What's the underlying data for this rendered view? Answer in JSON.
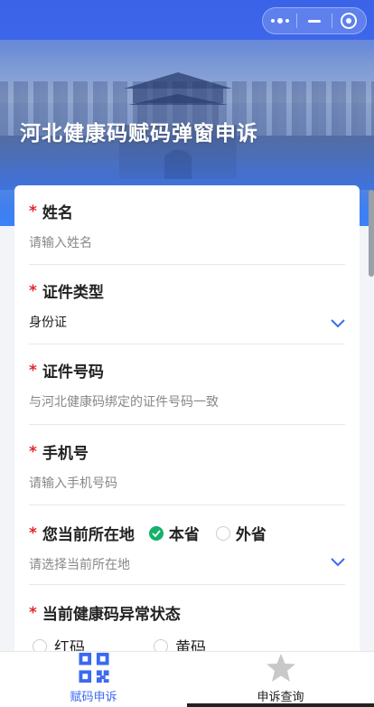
{
  "header": {
    "title": "河北健康码赋码弹窗申诉",
    "capsule": [
      "more-icon",
      "minimize-icon",
      "close-target-icon"
    ]
  },
  "form": {
    "required_mark": "*",
    "name": {
      "label": "姓名",
      "placeholder": "请输入姓名"
    },
    "id_type": {
      "label": "证件类型",
      "value": "身份证"
    },
    "id_number": {
      "label": "证件号码",
      "placeholder": "与河北健康码绑定的证件号码一致"
    },
    "phone": {
      "label": "手机号",
      "placeholder": "请输入手机号码"
    },
    "location": {
      "label": "您当前所在地",
      "options": [
        "本省",
        "外省"
      ],
      "selected": "本省",
      "placeholder": "请选择当前所在地"
    },
    "status": {
      "label": "当前健康码异常状态",
      "options": [
        "红码",
        "黄码"
      ]
    }
  },
  "tabbar": {
    "tabs": [
      {
        "label": "赋码申诉",
        "icon": "qr-code-icon",
        "active": true
      },
      {
        "label": "申诉查询",
        "icon": "star-icon",
        "active": false
      }
    ]
  },
  "colors": {
    "primary": "#3b6af0",
    "required": "#e0262e",
    "checked": "#12b26b"
  }
}
